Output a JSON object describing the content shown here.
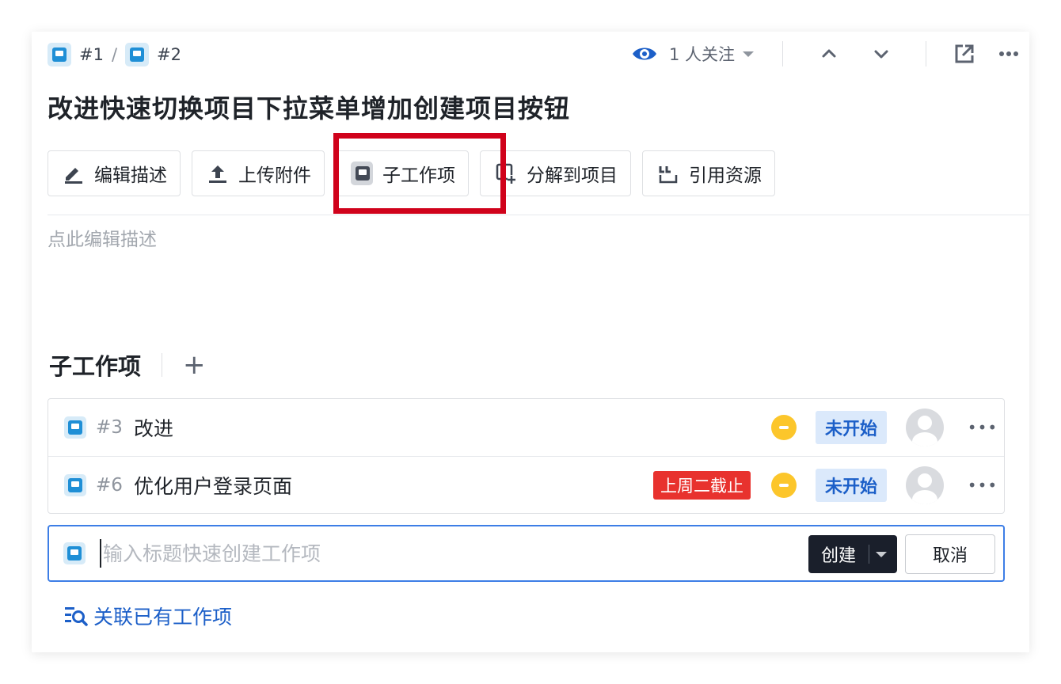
{
  "breadcrumb": {
    "first": "#1",
    "separator": "/",
    "second": "#2"
  },
  "header": {
    "watchers": "1 人关注"
  },
  "title": "改进快速切换项目下拉菜单增加创建项目按钮",
  "toolbar": {
    "edit": "编辑描述",
    "upload": "上传附件",
    "subitem": "子工作项",
    "split": "分解到项目",
    "cite": "引用资源"
  },
  "description": {
    "placeholder": "点此编辑描述"
  },
  "subitems": {
    "title": "子工作项",
    "plus": "+",
    "rows": [
      {
        "num": "#3",
        "title": "改进",
        "due": "",
        "status": "未开始"
      },
      {
        "num": "#6",
        "title": "优化用户登录页面",
        "due": "上周二截止",
        "status": "未开始"
      }
    ],
    "more": "•••"
  },
  "quick_create": {
    "placeholder": "输入标题快速创建工作项",
    "create": "创建",
    "cancel": "取消"
  },
  "link_existing": "关联已有工作项",
  "colors": {
    "accent": "#1c5fc8",
    "highlight": "#d0021b",
    "due": "#e8322e",
    "priority": "#fcc62b",
    "status_bg": "#dbe9fb"
  }
}
